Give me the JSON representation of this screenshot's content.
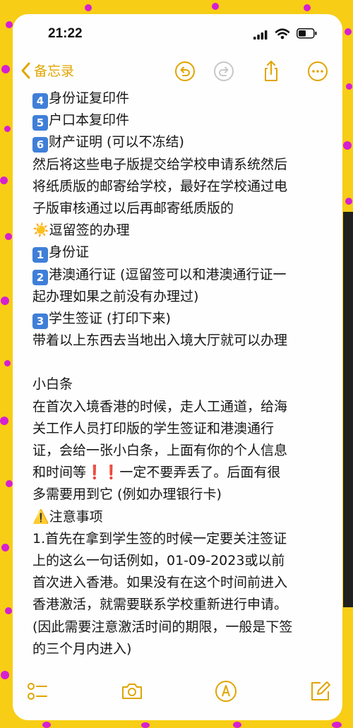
{
  "status_bar": {
    "time": "21:22"
  },
  "nav": {
    "back_label": "备忘录"
  },
  "colors": {
    "accent": "#e0a500",
    "background": "#f7cd16",
    "dots": "#d61fd2",
    "keycap": "#3f7fd8"
  },
  "icons": {
    "back": "chevron-left-icon",
    "undo": "undo-icon",
    "redo": "redo-icon",
    "share": "share-icon",
    "more": "ellipsis-icon",
    "checklist": "checklist-icon",
    "camera": "camera-icon",
    "markup": "pen-markup-icon",
    "compose": "compose-icon"
  },
  "note": {
    "list1": [
      {
        "num": "4",
        "text": "身份证复印件"
      },
      {
        "num": "5",
        "text": "户口本复印件"
      },
      {
        "num": "6",
        "text": "财产证明 (可以不冻结)"
      }
    ],
    "para1": [
      "然后将这些电子版提交给学校申请系统然后",
      "将纸质版的邮寄给学校，最好在学校通过电",
      "子版审核通过以后再邮寄纸质版的"
    ],
    "heading1_icon": "☀️",
    "heading1": "逗留签的办理",
    "list2": [
      {
        "num": "1",
        "text": "身份证"
      },
      {
        "num": "2",
        "text": "港澳通行证 (逗留签可以和港澳通行证一"
      }
    ],
    "list2_cont": "起办理如果之前没有办理过)",
    "list2b": [
      {
        "num": "3",
        "text": "学生签证 (打印下来)"
      }
    ],
    "para2": "带着以上东西去当地出入境大厅就可以办理",
    "heading2": "小白条",
    "para3": [
      "在首次入境香港的时候，走人工通道，给海",
      "关工作人员打印版的学生签证和港澳通行",
      "证，会给一张小白条，上面有你的个人信息"
    ],
    "para3_line4_pre": "和时间等",
    "para3_bang": "❗",
    "para3_line4_post": "一定不要弄丢了。后面有很",
    "para3_line5": "多需要用到它 (例如办理银行卡)",
    "warning_icon": "⚠️",
    "heading3": "注意事项",
    "para4": [
      "1.首先在拿到学生签的时候一定要关注签证",
      "上的这么一句话例如，01-09-2023或以前",
      "首次进入香港。如果没有在这个时间前进入",
      "香港激活，就需要联系学校重新进行申请。",
      "(因此需要注意激活时间的期限，一般是下签",
      "的三个月内进入)"
    ]
  }
}
